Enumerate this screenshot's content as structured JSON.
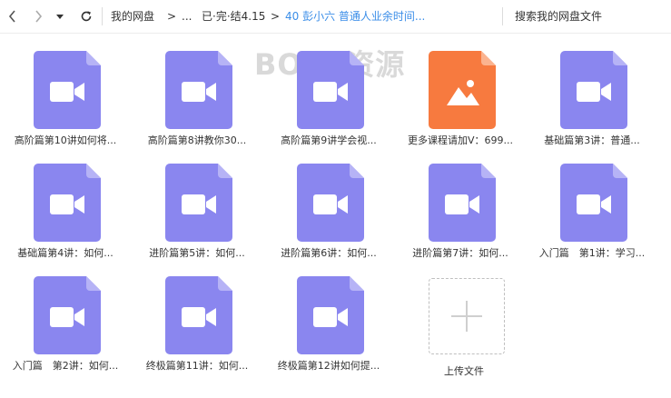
{
  "nav": {
    "back_icon": "chevron-left-icon",
    "forward_icon": "chevron-right-icon",
    "dropdown_icon": "caret-down-icon",
    "refresh_icon": "refresh-icon"
  },
  "breadcrumb": {
    "root": "我的网盘",
    "sep1": ">",
    "ellipsis": "...",
    "folder": "已·完·结4.15",
    "sep2": ">",
    "current": "40 彭小六 普通人业余时间..."
  },
  "search": {
    "label": "搜索我的网盘文件"
  },
  "watermark": "BOSS资源",
  "colors": {
    "video": "#8a86ef",
    "video_fold": "#b6b3f6",
    "image": "#f77a3f",
    "image_fold": "#fbb38f",
    "accent": "#3b8ee8"
  },
  "files": [
    {
      "name": "高阶篇第10讲如何将...",
      "type": "video",
      "icon": "video-file-icon"
    },
    {
      "name": "高阶篇第8讲教你30...",
      "type": "video",
      "icon": "video-file-icon"
    },
    {
      "name": "高阶篇第9讲学会视...",
      "type": "video",
      "icon": "video-file-icon"
    },
    {
      "name": "更多课程请加V：699...",
      "type": "image",
      "icon": "image-file-icon"
    },
    {
      "name": "基础篇第3讲：普通...",
      "type": "video",
      "icon": "video-file-icon"
    },
    {
      "name": "基础篇第4讲：如何...",
      "type": "video",
      "icon": "video-file-icon"
    },
    {
      "name": "进阶篇第5讲：如何...",
      "type": "video",
      "icon": "video-file-icon"
    },
    {
      "name": "进阶篇第6讲：如何...",
      "type": "video",
      "icon": "video-file-icon"
    },
    {
      "name": "进阶篇第7讲：如何...",
      "type": "video",
      "icon": "video-file-icon"
    },
    {
      "name": "入门篇　第1讲：学习...",
      "type": "video",
      "icon": "video-file-icon"
    },
    {
      "name": "入门篇　第2讲：如何...",
      "type": "video",
      "icon": "video-file-icon"
    },
    {
      "name": "终极篇第11讲：如何...",
      "type": "video",
      "icon": "video-file-icon"
    },
    {
      "name": "终极篇第12讲如何提...",
      "type": "video",
      "icon": "video-file-icon"
    }
  ],
  "upload": {
    "label": "上传文件",
    "icon": "plus-icon"
  }
}
